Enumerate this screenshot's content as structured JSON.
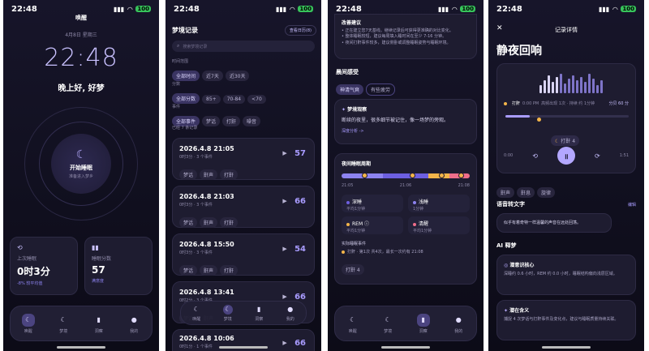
{
  "status": {
    "time": "22:48",
    "battery": "100"
  },
  "screen1": {
    "title": "唤醒",
    "date": "4月8日 星期三",
    "clock": "22:48",
    "greeting": "晚上好, 好梦",
    "start_label": "开始睡眠",
    "start_sub": "准备进入梦乡",
    "last_sleep_label": "上次睡眠",
    "last_sleep_value": "0时3分",
    "last_sleep_delta": "-8% 较平均值",
    "score_label": "睡眠分数",
    "score_value": "57",
    "score_sub": "满意度"
  },
  "nav": {
    "items": [
      "唤醒",
      "梦境",
      "洞察",
      "我的"
    ]
  },
  "screen2": {
    "title": "梦境记录",
    "view_button": "查看日历(8)",
    "search_placeholder": "搜索梦境记录",
    "time_label": "时间范围",
    "time_chips": [
      "全部时间",
      "近7天",
      "近30天"
    ],
    "score_label": "分数",
    "score_chips": [
      "全部分数",
      "85+",
      "70-84",
      "<70"
    ],
    "event_label": "事件",
    "event_chips": [
      "全部事件",
      "梦话",
      "打鼾",
      "噪音"
    ],
    "count_label": "已经 7 条记录",
    "records": [
      {
        "title": "2026.4.8 21:05",
        "meta": "0时3分 · 3 个事件",
        "score": "57",
        "tags": [
          "梦话",
          "鼾声",
          "打鼾"
        ]
      },
      {
        "title": "2026.4.8 21:03",
        "meta": "0时3分 · 3 个事件",
        "score": "66",
        "tags": [
          "梦话",
          "鼾声",
          "打鼾"
        ]
      },
      {
        "title": "2026.4.8 15:50",
        "meta": "0时3分 · 3 个事件",
        "score": "54",
        "tags": [
          "梦话",
          "鼾声",
          "打鼾"
        ]
      },
      {
        "title": "2026.4.8 13:41",
        "meta": "0时2分 · 3 个事件",
        "score": "66",
        "tags": [
          "梦话",
          "鼾声"
        ]
      },
      {
        "title": "2026.4.8 10:06",
        "meta": "0时1分 · 1 个事件",
        "score": "66",
        "tags": []
      }
    ]
  },
  "screen3": {
    "tips_title": "改善建议",
    "tips": [
      "• 正在建立您7天基线。继续记录后可获得更准确的对比变化。",
      "• 整体睡眠较短，建议每周填入睡时间在至少 7-16 分钟。",
      "• 夜间打鼾事件较多，建议侧卧或调整睡眠姿势与睡眠环境。"
    ],
    "feel_title": "晨间感受",
    "feel_chips": [
      "神清气爽",
      "有些疲劳"
    ],
    "dream_title": "梦境观察",
    "dream_text": "断续的夜里，很多细节被记住，像一场梦的旁观。",
    "dream_link": "深度分析 ->",
    "timeline_title": "夜间睡眠周期",
    "timeline_times": [
      "21:05",
      "21:06",
      "21:08"
    ],
    "stages": [
      {
        "name": "深睡",
        "value": "平均1分钟"
      },
      {
        "name": "浅睡",
        "value": "1分钟"
      },
      {
        "name": "REM ⓘ",
        "value": "平均1分钟"
      },
      {
        "name": "清醒",
        "value": "平均1分钟"
      }
    ],
    "events_title": "实际睡眠事件",
    "event_line": "打鼾 · 第1次 共4次，最长一次约有 21:08",
    "event_chip": "打鼾 4",
    "colors": {
      "deep": "#6d5fe0",
      "light": "#8d83f0",
      "rem": "#f3b54a",
      "awake": "#ef6e8a"
    }
  },
  "screen4": {
    "header": "记录详情",
    "title": "静夜回响",
    "snore_label": "打鼾",
    "snore_time": "0:00 PM",
    "snore_meta": "高频出现 1次 · 持续 约 1分钟",
    "snore_score": "分贝 60 分",
    "chip_label": "打鼾 4",
    "time_start": "0:00",
    "time_end": "1:51",
    "tags": [
      "鼾声",
      "鼾息",
      "旋律"
    ],
    "transcript_title": "语音转文字",
    "transcript_action": "编辑",
    "transcript_text": "似乎有着奇特一样温馨的声音在远处回荡。",
    "ai_title": "AI 释梦",
    "ai_items": [
      {
        "title": "潜意识核心",
        "text": "深睡约 0.6 小时，REM 约 0.0 小时，睡眠结构偏向浅层区域。"
      },
      {
        "title": "潜在含义",
        "text": "捕捉 4 次梦话与打鼾事件及变化点，建议与睡眠质量持续关联。"
      }
    ]
  }
}
